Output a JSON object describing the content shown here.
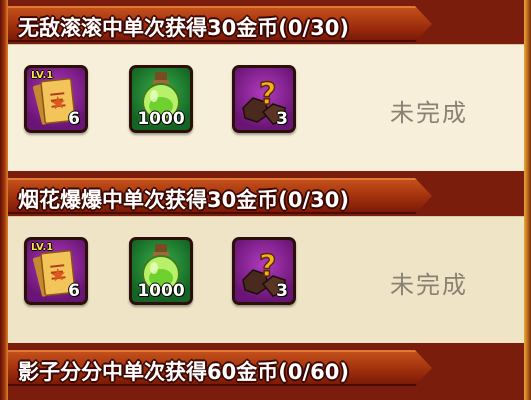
{
  "quests": [
    {
      "title": "无敌滚滚中单次获得30金币(0/30)",
      "status": "未完成",
      "rewards": [
        {
          "icon": "scroll-card-icon",
          "level": "LV.1",
          "count": "6"
        },
        {
          "icon": "green-potion-bottle-icon",
          "count": "1000"
        },
        {
          "icon": "mystery-ore-icon",
          "count": "3"
        }
      ]
    },
    {
      "title": "烟花爆爆中单次获得30金币(0/30)",
      "status": "未完成",
      "rewards": [
        {
          "icon": "scroll-card-icon",
          "level": "LV.1",
          "count": "6"
        },
        {
          "icon": "green-potion-bottle-icon",
          "count": "1000"
        },
        {
          "icon": "mystery-ore-icon",
          "count": "3"
        }
      ]
    },
    {
      "title": "影子分分中单次获得60金币(0/60)"
    }
  ],
  "colors": {
    "header": "#a0300d",
    "body": "#f7efd9",
    "rare_frame": "#6a1575",
    "common_frame": "#146524",
    "status_text": "#8a8175"
  }
}
